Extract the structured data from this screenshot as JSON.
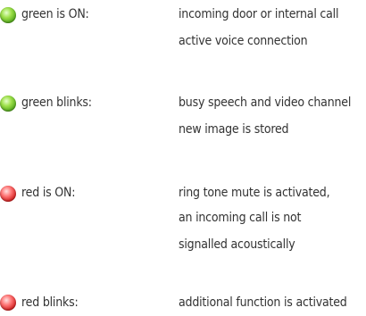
{
  "legend": [
    {
      "state": "green",
      "label": "green is ON:",
      "lines": [
        "incoming door or internal call",
        "active voice connection"
      ]
    },
    {
      "state": "green",
      "label": "green blinks:",
      "lines": [
        "busy speech and video channel",
        "new image is stored"
      ]
    },
    {
      "state": "red",
      "label": "red is ON:",
      "lines": [
        "ring tone mute is activated,",
        "an incoming call is not",
        "signalled acoustically"
      ]
    },
    {
      "state": "red",
      "label": "red blinks:",
      "lines": [
        "additional function is activated"
      ]
    }
  ]
}
